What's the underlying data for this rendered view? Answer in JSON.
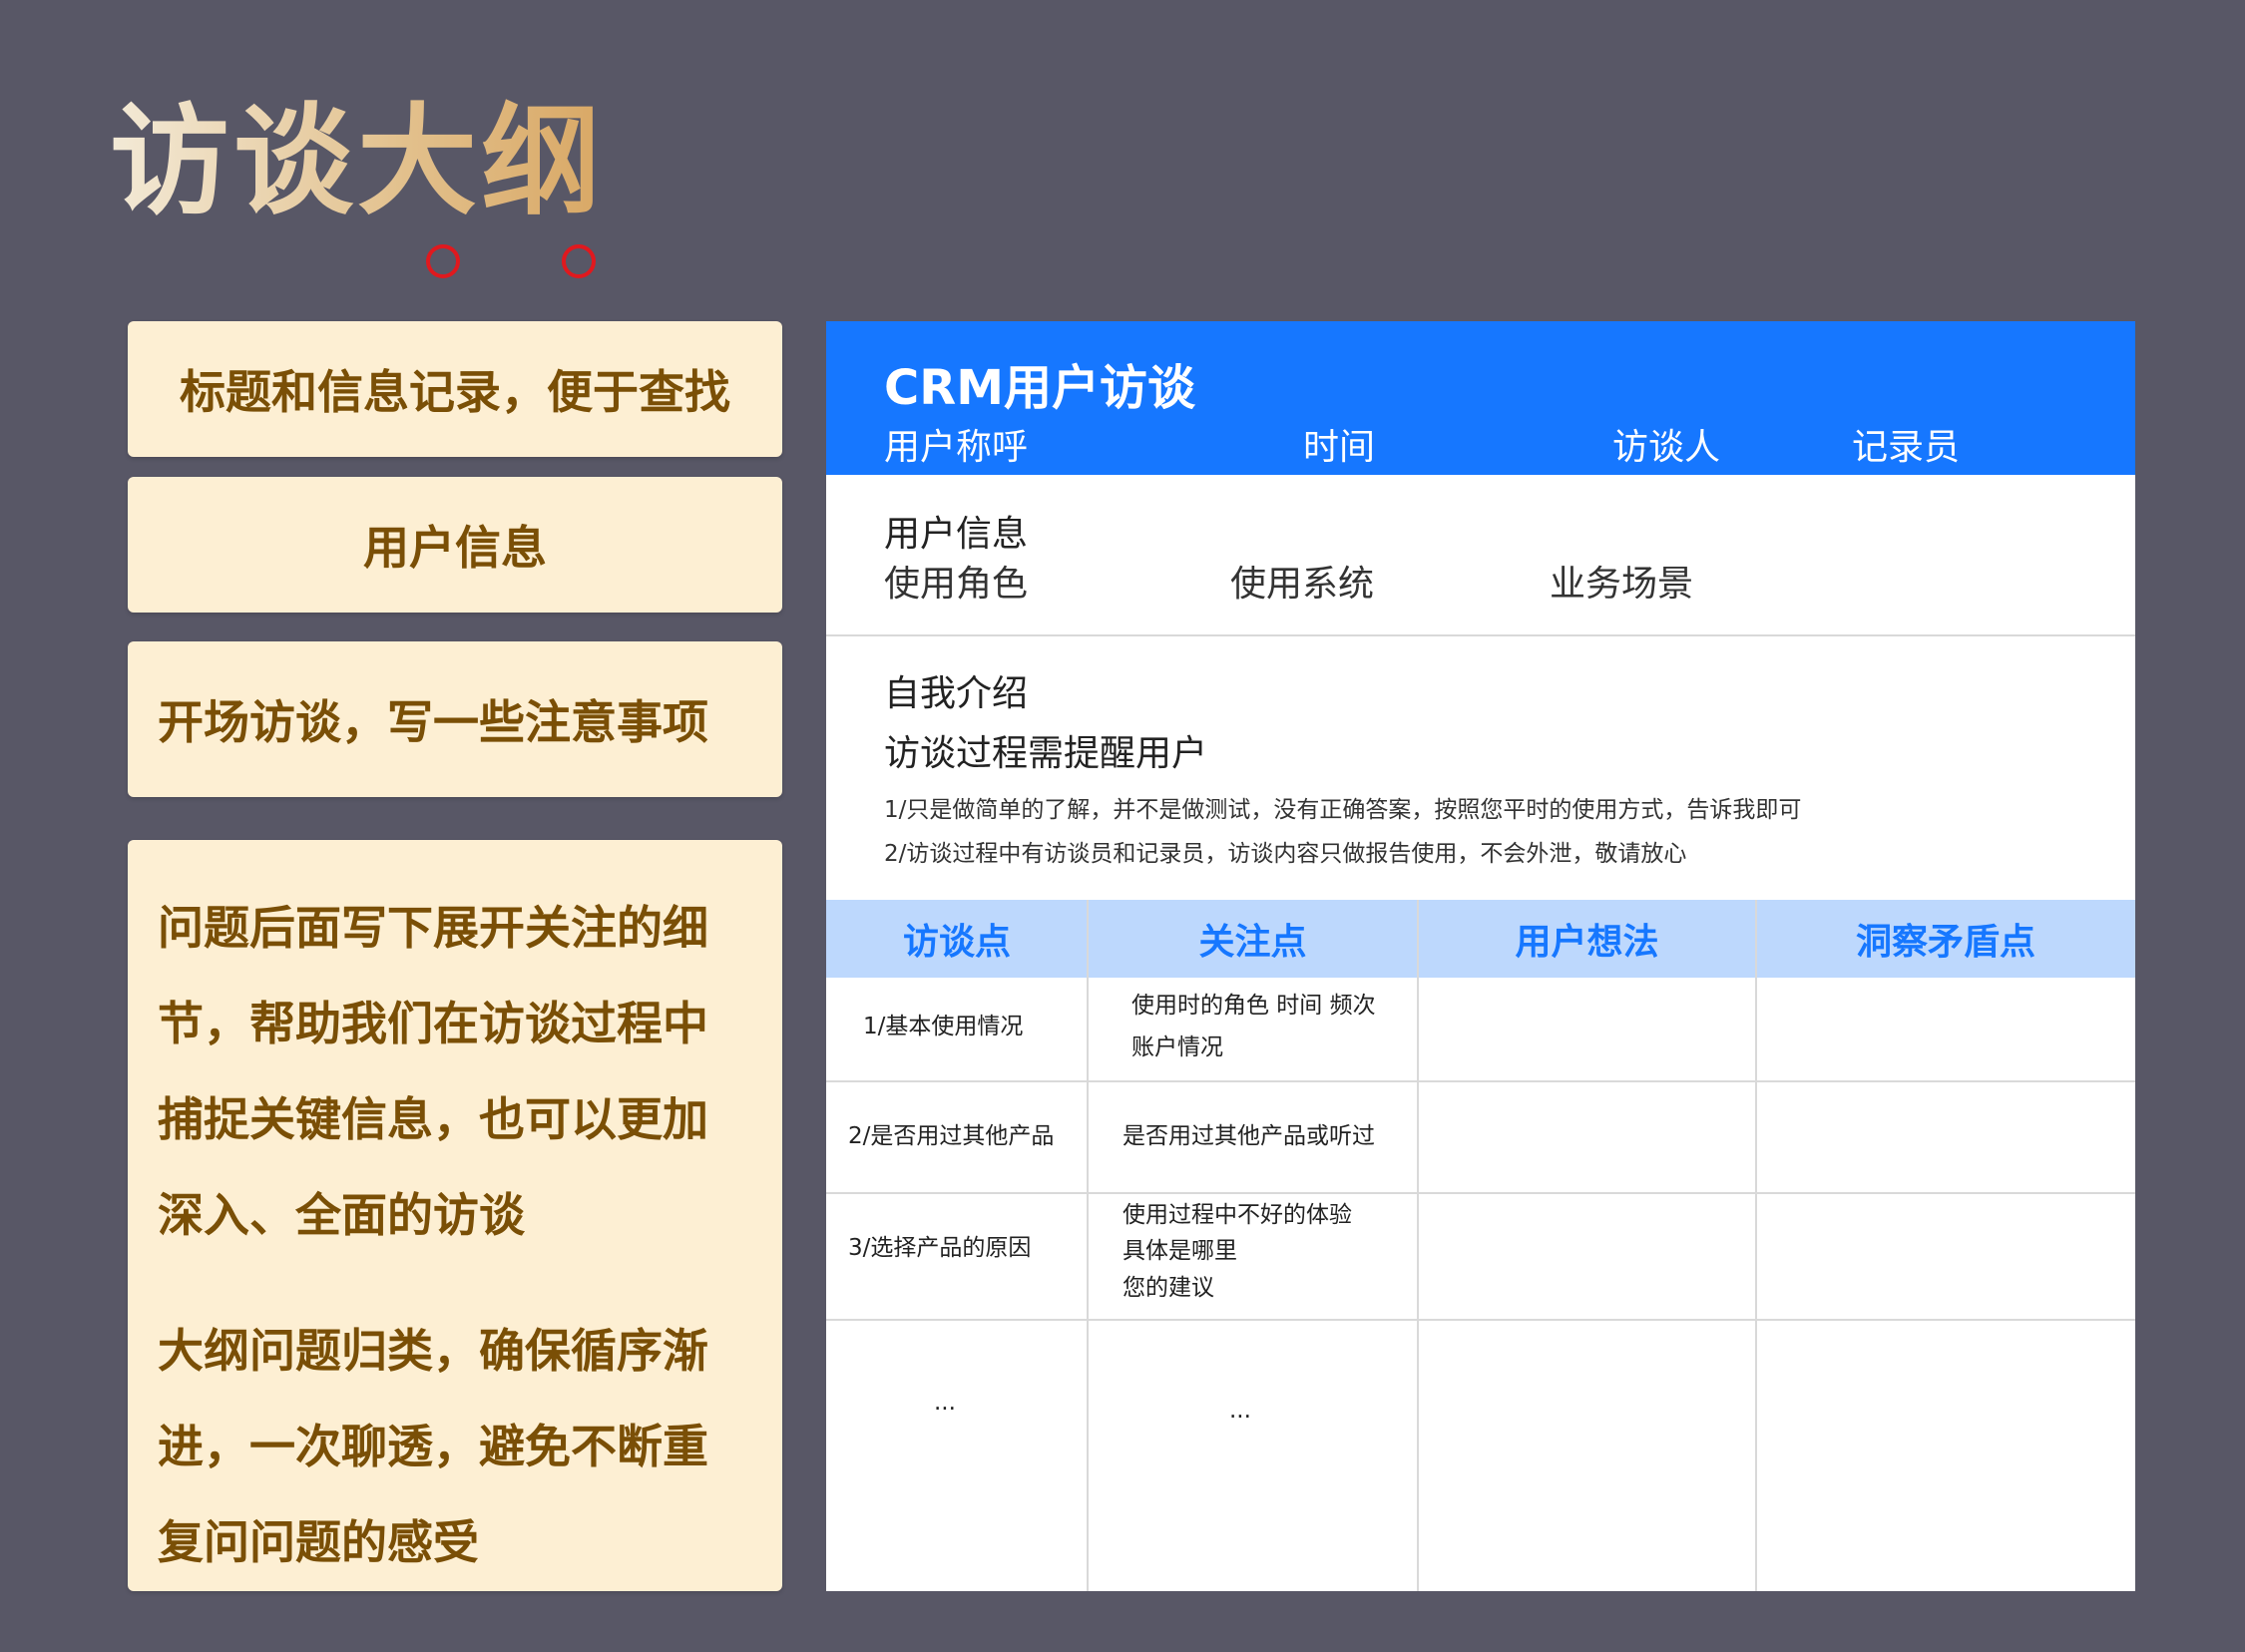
{
  "page": {
    "title": "访谈大纲"
  },
  "notes": {
    "n1": "标题和信息记录，便于查找",
    "n2": "用户信息",
    "n3": "开场访谈，写一些注意事项",
    "n4_lines": [
      "问题后面写下展开关注的细",
      "节，帮助我们在访谈过程中",
      "捕捉关键信息，也可以更加",
      "深入、全面的访谈"
    ],
    "n5_lines": [
      "大纲问题归类，确保循序渐",
      "进，一次聊透，避免不断重",
      "复问问题的感受"
    ]
  },
  "card": {
    "title": "CRM用户访谈",
    "meta": [
      "用户称呼",
      "时间",
      "访谈人",
      "记录员"
    ],
    "user_info": {
      "heading": "用户信息",
      "items": [
        "使用角色",
        "使用系统",
        "业务场景"
      ]
    },
    "intro": {
      "heading": "自我介绍",
      "subheading": "访谈过程需提醒用户",
      "notes": [
        "1/只是做简单的了解，并不是做测试，没有正确答案，按照您平时的使用方式，告诉我即可",
        "2/访谈过程中有访谈员和记录员，访谈内容只做报告使用，不会外泄，敬请放心"
      ]
    },
    "table": {
      "headers": [
        "访谈点",
        "关注点",
        "用户想法",
        "洞察矛盾点"
      ],
      "rows": [
        {
          "point": "1/基本使用情况",
          "focus": [
            "使用时的角色 时间 频次",
            "账户情况"
          ]
        },
        {
          "point": "2/是否用过其他产品",
          "focus": [
            "是否用过其他产品或听过"
          ]
        },
        {
          "point": "3/选择产品的原因",
          "focus": [
            "使用过程中不好的体验",
            "具体是哪里",
            "您的建议"
          ]
        },
        {
          "point": "...",
          "focus": [
            "..."
          ]
        }
      ]
    }
  },
  "colors": {
    "background": "#585766",
    "note_bg": "#fdefd3",
    "note_text": "#7a4f06",
    "header_blue": "#1677ff",
    "table_header_bg": "#bdd8fd",
    "circle_red": "#e0191e"
  }
}
